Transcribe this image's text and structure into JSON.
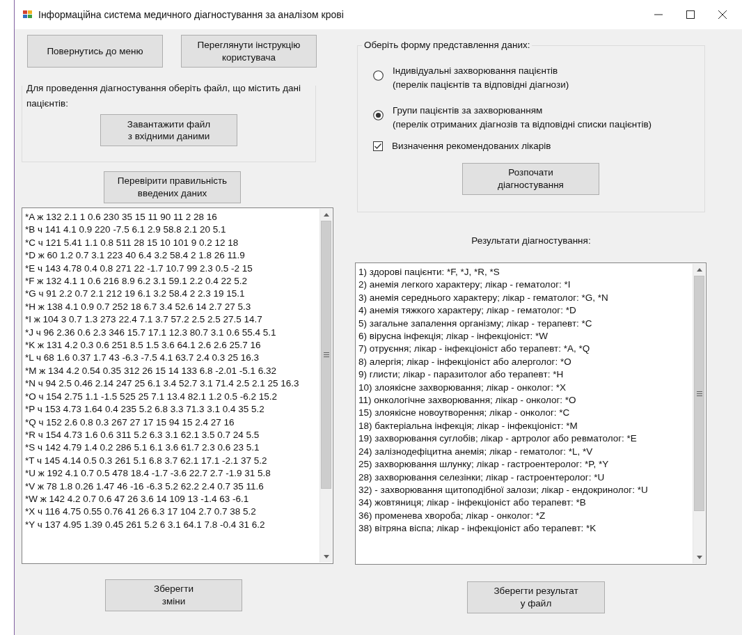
{
  "window": {
    "title": "Інформаційна система медичного діагностування за аналізом крові"
  },
  "top_buttons": [
    "Повернутись до меню",
    "Переглянути інструкцію\nкористувача"
  ],
  "file_group": {
    "legend": "Для проведення діагностування оберіть файл, що містить дані пацієнтів:",
    "load_button": "Завантажити файл\nз вхідними даними"
  },
  "check_button": "Перевірити правильність\nвведених даних",
  "patient_data": {
    "lines": [
      "*A ж 132 2.1 1 0.6 230 35 15 11 90 11 2 28 16",
      "*B ч 141 4.1 0.9 220 -7.5 6.1 2.9 58.8 2.1 20 5.1",
      "*C ч 121 5.41 1.1 0.8 511 28 15 10 101 9 0.2 12 18",
      "*D ж 60 1.2 0.7 3.1 223 40 6.4 3.2 58.4 2 1.8 26 11.9",
      "*E ч 143 4.78 0.4 0.8 271 22 -1.7 10.7 99 2.3 0.5 -2 15",
      "*F ж 132 4.1 1 0.6 216 8.9 6.2 3.1 59.1 2.2 0.4 22 5.2",
      "*G ч 91 2.2 0.7 2.1 212 19 6.1 3.2 58.4 2 2.3 19 15.1",
      "*H ж 138 4.1 0.9 0.7 252 18 6.7 3.4 52.6 14 2.7 27 5.3",
      "*I ж 104 3 0.7 1.3 273 22.4 7.1 3.7 57.2 2.5 2.5 27.5 14.7",
      "*J ч 96 2.36 0.6 2.3 346 15.7 17.1 12.3 80.7 3.1 0.6 55.4 5.1",
      "*K ж 131 4.2 0.3 0.6 251 8.5 1.5 3.6 64.1 2.6 2.6 25.7 16",
      "*L ч 68 1.6 0.37 1.7 43 -6.3 -7.5 4.1 63.7 2.4 0.3 25 16.3",
      "*M ж 134 4.2 0.54 0.35 312 26 15 14 133 6.8 -2.01 -5.1 6.32",
      "*N ч 94 2.5 0.46 2.14 247 25 6.1 3.4 52.7 3.1 71.4 2.5 2.1 25 16.3",
      "*O ч 154 2.75 1.1 -1.5 525 25 7.1 13.4 82.1 1.2 0.5 -6.2 15.2",
      "*P ч 153 4.73 1.64 0.4 235 5.2 6.8 3.3 71.3 3.1 0.4 35 5.2",
      "*Q ч 152 2.6 0.8 0.3 267 27 17 15 94 15 2.4 27 16",
      "*R ч 154 4.73 1.6 0.6 311 5.2 6.3 3.1 62.1 3.5 0.7 24 5.5",
      "*S ч 142 4.79 1.4 0.2 286 5.1 6.1 3.6 61.7 2.3 0.6 23 5.1",
      "*T ч 145 4.14 0.5 0.3 261 5.1 6.8 3.7 62.1 17.1 -2.1 37 5.2",
      "*U ж 192 4.1 0.7 0.5 478 18.4 -1.7 -3.6 22.7 2.7 -1.9 31 5.8",
      "*V ж 78 1.8 0.26 1.47 46 -16 -6.3 5.2 62.2 2.4 0.7 35 11.6",
      "*W ж 142 4.2 0.7 0.6 47 26 3.6 14 109 13 -1.4 63 -6.1",
      "*X ч 116 4.75 0.55 0.76 41 26 6.3 17 104 2.7 0.7 38 5.2",
      "*Y ч 137 4.95 1.39 0.45 261 5.2 6 3.1 64.1 7.8 -0.4 31 6.2"
    ]
  },
  "save_changes_button": "Зберегти\nзміни",
  "format_group": {
    "legend": "Оберіть форму представлення даних:",
    "options": [
      {
        "label": "Індивідуальні захворювання пацієнтів",
        "note": "(перелік пацієнтів та відповідні діагнози)",
        "selected": false
      },
      {
        "label": "Групи пацієнтів за захворюванням",
        "note": "(перелік отриманих діагнозів та відповідні списки пацієнтів)",
        "selected": true
      }
    ],
    "recommend_doctors": {
      "label": "Визначення рекомендованих лікарів",
      "checked": true
    }
  },
  "start_button": "Розпочати\nдіагностування",
  "results_label": "Результати діагностування:",
  "results": {
    "lines": [
      "1) здорові пацієнти: *F, *J, *R, *S",
      "2) анемія легкого характеру; лікар - гематолог: *I",
      "3) анемія середнього характеру; лікар - гематолог: *G, *N",
      "4) анемія тяжкого характеру; лікар - гематолог: *D",
      "5) загальне запалення організму; лікар - терапевт: *C",
      "6) вірусна інфекція; лікар - інфекціоніст: *W",
      "7) отруєння; лікар - інфекціоніст або терапевт: *A, *Q",
      "8) алергія; лікар - інфекціоніст або алерголог: *O",
      "9) глисти; лікар - паразитолог або терапевт: *H",
      "10) злоякісне захворювання; лікар - онколог: *X",
      "11) онкологічне захворювання; лікар - онколог: *O",
      "15) злоякісне новоутворення; лікар - онколог: *C",
      "18) бактеріальна інфекція; лікар - інфекціоніст: *M",
      "19) захворювання суглобів; лікар - артролог або ревматолог: *E",
      "24) залізнодефіцитна анемія; лікар - гематолог: *L, *V",
      "25) захворювання шлунку; лікар - гастроентеролог: *P, *Y",
      "28) захворювання селезінки; лікар - гастроентеролог: *U",
      "32) - захворювання щитоподібної залози; лікар - ендокринолог: *U",
      "34) жовтяниця; лікар - інфекціоніст або терапевт: *B",
      "36) променева хвороба; лікар - онколог: *Z",
      "38) вітряна віспа; лікар - інфекціоніст або терапевт: *K"
    ]
  },
  "save_results_button": "Зберегти результат\nу файл"
}
